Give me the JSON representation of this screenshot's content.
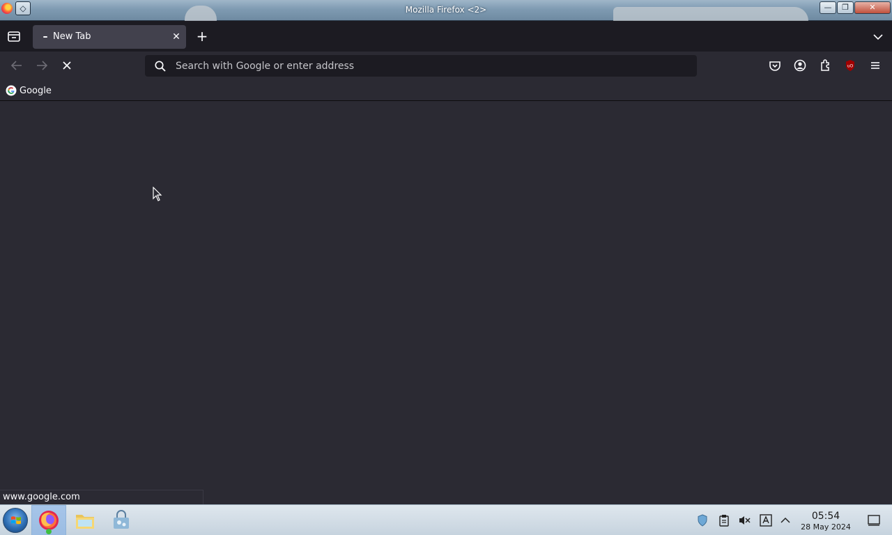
{
  "window": {
    "title": "Mozilla Firefox <2>"
  },
  "tabs": [
    {
      "label": "New Tab",
      "loading": true
    }
  ],
  "urlbar": {
    "placeholder": "Search with Google or enter address",
    "value": ""
  },
  "bookmarks": [
    {
      "label": "Google",
      "icon": "google-g-icon"
    }
  ],
  "status": {
    "url": "www.google.com"
  },
  "toolbar_icons": [
    "back-icon",
    "forward-icon",
    "stop-icon",
    "search-icon",
    "pocket-icon",
    "account-icon",
    "extensions-icon",
    "ublock-origin-icon",
    "menu-icon"
  ],
  "taskbar": {
    "apps": [
      "start-menu-icon",
      "firefox-icon",
      "file-manager-icon",
      "software-center-icon"
    ],
    "clock": {
      "time": "05:54",
      "date": "28 May 2024"
    }
  },
  "colors": {
    "chrome_bg": "#1c1b22",
    "toolbar_bg": "#2b2a33",
    "active_tab": "#42414d",
    "text": "#fbfbfe",
    "ublock_red": "#a00000"
  }
}
